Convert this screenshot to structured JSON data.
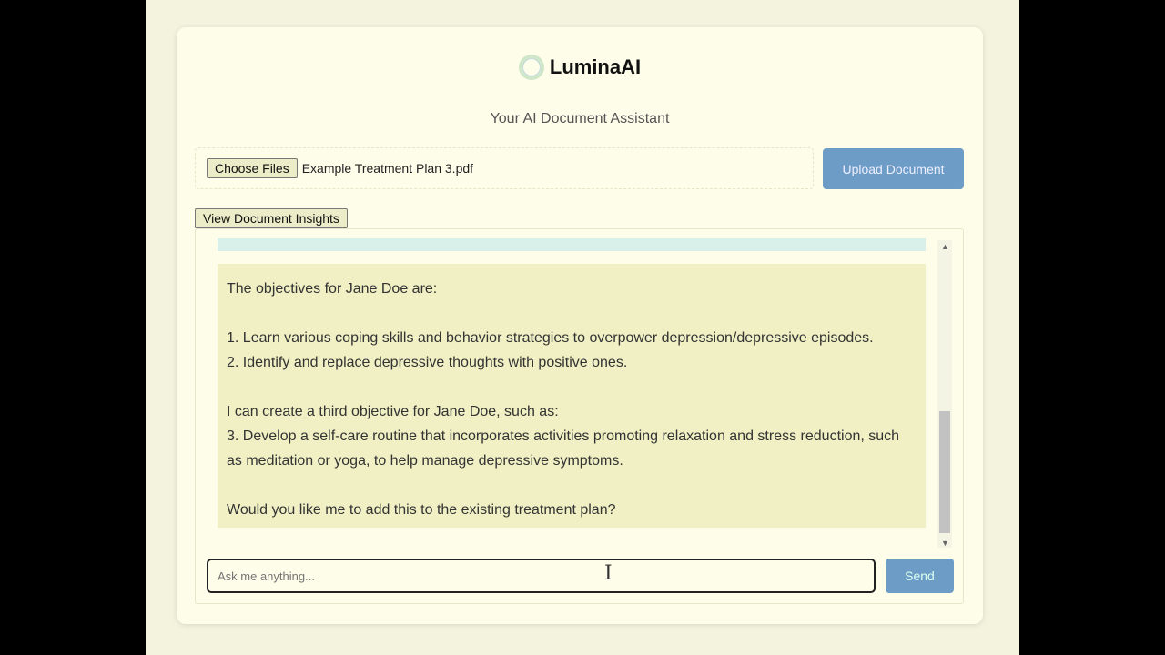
{
  "header": {
    "app_name": "LuminaAI",
    "subtitle": "Your AI Document Assistant"
  },
  "upload": {
    "choose_label": "Choose Files",
    "file_name": "Example Treatment Plan 3.pdf",
    "upload_label": "Upload Document"
  },
  "insights_label": "View Document Insights",
  "chat": {
    "message": "The objectives for Jane Doe are:\n\n1. Learn various coping skills and behavior strategies to overpower depression/depressive episodes.\n2. Identify and replace depressive thoughts with positive ones.\n\nI can create a third objective for Jane Doe, such as:\n3. Develop a self-care routine that incorporates activities promoting relaxation and stress reduction, such as meditation or yoga, to help manage depressive symptoms.\n\nWould you like me to add this to the existing treatment plan?",
    "input_placeholder": "Ask me anything...",
    "send_label": "Send"
  }
}
